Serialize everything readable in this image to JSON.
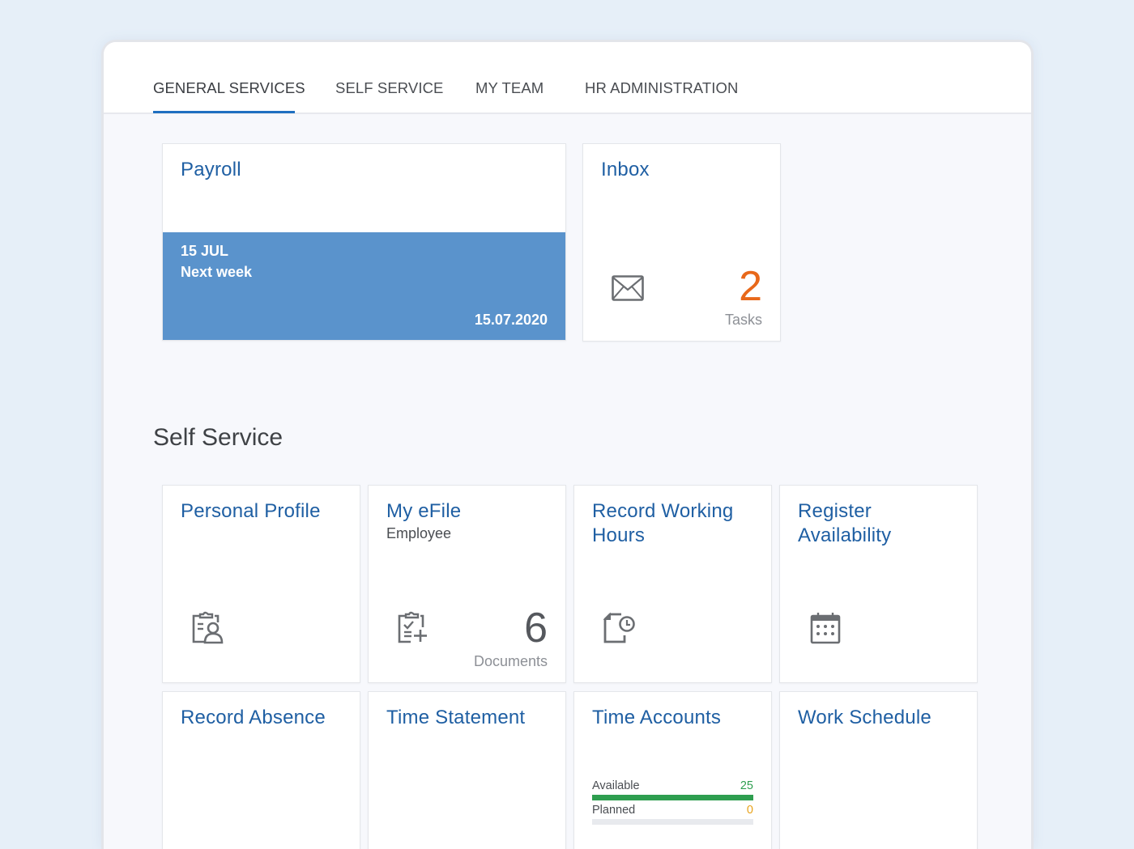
{
  "tabs": [
    {
      "label": "GENERAL SERVICES",
      "active": true
    },
    {
      "label": "SELF SERVICE",
      "active": false
    },
    {
      "label": "MY TEAM",
      "active": false
    },
    {
      "label": "HR ADMINISTRATION",
      "active": false
    }
  ],
  "general": {
    "payroll": {
      "title": "Payroll",
      "date_short": "15 JUL",
      "relative": "Next week",
      "date_full": "15.07.2020",
      "band_color": "#5a93cc"
    },
    "inbox": {
      "title": "Inbox",
      "icon": "envelope-icon",
      "count": "2",
      "unit": "Tasks",
      "count_color": "#e8681a"
    }
  },
  "self_service": {
    "section_title": "Self Service",
    "tiles": [
      {
        "title": "Personal Profile",
        "icon": "clipboard-person-icon"
      },
      {
        "title": "My eFile",
        "subtitle": "Employee",
        "icon": "clipboard-check-add-icon",
        "count": "6",
        "unit": "Documents"
      },
      {
        "title": "Record Working Hours",
        "icon": "document-clock-icon"
      },
      {
        "title": "Register Availability",
        "icon": "calendar-icon"
      },
      {
        "title": "Record Absence"
      },
      {
        "title": "Time Statement"
      },
      {
        "title": "Time Accounts",
        "accounts": [
          {
            "label": "Available",
            "value": "25",
            "fill_fraction": 1.0,
            "color": "#2e9e4f"
          },
          {
            "label": "Planned",
            "value": "0",
            "fill_fraction": 0.0,
            "color": "#e8a21a"
          }
        ]
      },
      {
        "title": "Work Schedule"
      }
    ]
  },
  "colors": {
    "accent": "#1f6fc0",
    "tile_title": "#1f5fa3",
    "page_bg": "#e6eff8"
  }
}
